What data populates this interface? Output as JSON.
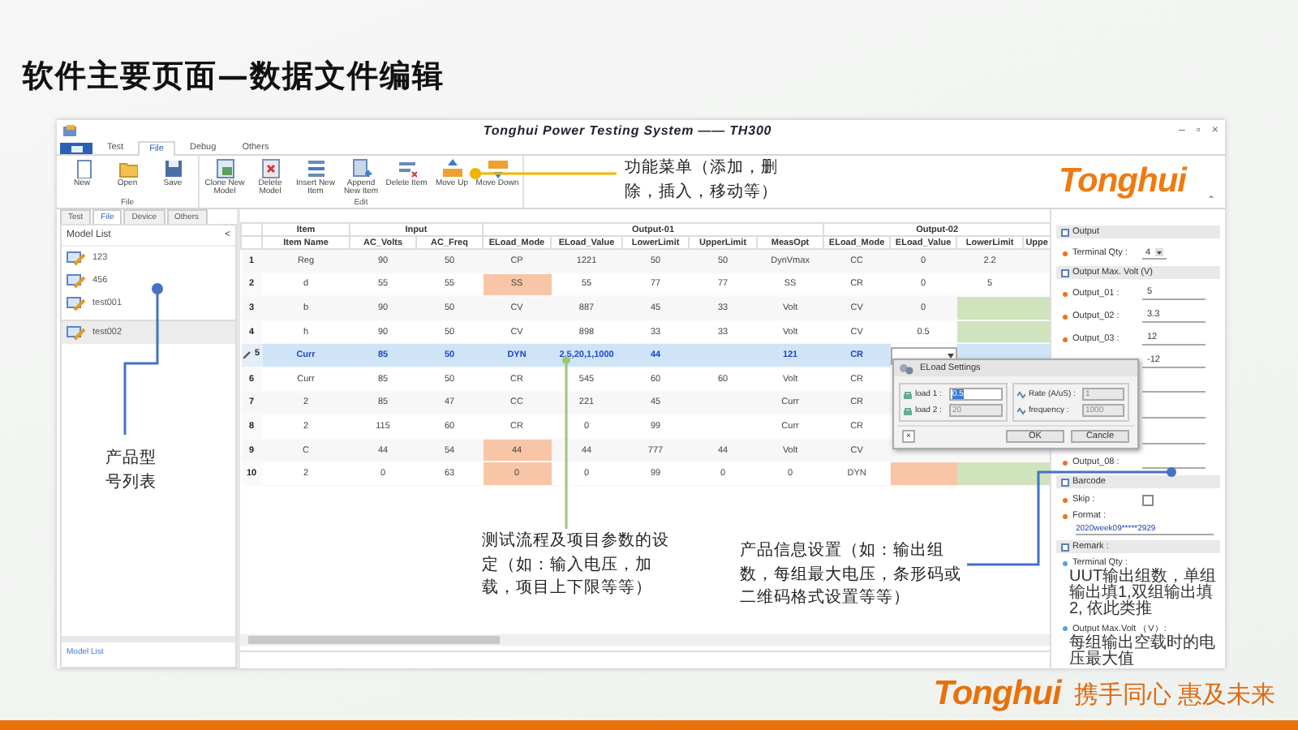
{
  "slide": {
    "title": "软件主要页面—数据文件编辑",
    "footer_logo": "Tonghui",
    "footer_slogan": "携手同心 惠及未来"
  },
  "window": {
    "title": "Tonghui Power Testing System —— TH300",
    "controls": [
      "–",
      "▫",
      "×"
    ],
    "logo": "Tonghui",
    "collapse": "⌃"
  },
  "ribbon_tabs": [
    {
      "label": "Test",
      "selected": false
    },
    {
      "label": "File",
      "selected": true
    },
    {
      "label": "Debug",
      "selected": false
    },
    {
      "label": "Others",
      "selected": false
    }
  ],
  "ribbon_groups": [
    {
      "label": "File",
      "buttons": [
        "New",
        "Open",
        "Save"
      ]
    },
    {
      "label": "Edit",
      "buttons": [
        "Clone New Model",
        "Delete Model",
        "Insert New Item",
        "Append New Item",
        "Delete Item",
        "Move Up",
        "Move Down"
      ]
    }
  ],
  "left_panel": {
    "tabs": [
      {
        "label": "Test",
        "selected": false
      },
      {
        "label": "File",
        "selected": true
      },
      {
        "label": "Device",
        "selected": false
      },
      {
        "label": "Others",
        "selected": false
      }
    ],
    "header": "Model List",
    "collapse": "<",
    "models": [
      {
        "name": "123",
        "selected": false
      },
      {
        "name": "456",
        "selected": false
      },
      {
        "name": "test001",
        "selected": false
      },
      {
        "name": "test002",
        "selected": true
      }
    ],
    "footer": "Model List"
  },
  "table": {
    "groups": [
      "Item",
      "Input",
      "Output-01",
      "Output-02"
    ],
    "columns": [
      "Item Name",
      "AC_Volts",
      "AC_Freq",
      "ELoad_Mode",
      "ELoad_Value",
      "LowerLimit",
      "UpperLimit",
      "MeasOpt",
      "ELoad_Mode",
      "ELoad_Value",
      "LowerLimit",
      "Uppe"
    ],
    "rows": [
      {
        "number": "1",
        "selected": false,
        "cells": [
          "Reg",
          "90",
          "50",
          "CP",
          "1221",
          "50",
          "50",
          "DynVmax",
          "CC",
          "0",
          "2.2"
        ]
      },
      {
        "number": "2",
        "selected": false,
        "cells": [
          "d",
          "55",
          "55",
          {
            "text": "SS",
            "color": "#f8c6a6"
          },
          "55",
          "77",
          "77",
          "SS",
          "CR",
          "0",
          "5"
        ]
      },
      {
        "number": "3",
        "selected": false,
        "cells": [
          "b",
          "90",
          "50",
          "CV",
          "887",
          "45",
          "33",
          "Volt",
          "CV",
          "0",
          {
            "color": "#cfe3bd"
          },
          {
            "color": "#cfe3bd"
          }
        ]
      },
      {
        "number": "4",
        "selected": false,
        "cells": [
          "h",
          "90",
          "50",
          "CV",
          "898",
          "33",
          "33",
          "Volt",
          "CV",
          "0.5",
          {
            "color": "#cfe3bd"
          },
          {
            "color": "#cfe3bd"
          }
        ]
      },
      {
        "number": "5",
        "selected": true,
        "cells": [
          "Curr",
          "85",
          "50",
          "DYN",
          "2.5,20,1,1000",
          "44",
          null,
          "121",
          "CR",
          {
            "kind": "dropdown"
          }
        ]
      },
      {
        "number": "6",
        "selected": false,
        "cells": [
          "Curr",
          "85",
          "50",
          "CR",
          "545",
          "60",
          "60",
          "Volt",
          "CR"
        ]
      },
      {
        "number": "7",
        "selected": false,
        "cells": [
          "2",
          "85",
          "47",
          "CC",
          "221",
          "45",
          null,
          "Curr",
          "CR"
        ]
      },
      {
        "number": "8",
        "selected": false,
        "cells": [
          "2",
          "115",
          "60",
          "CR",
          "0",
          "99",
          null,
          "Curr",
          "CR"
        ]
      },
      {
        "number": "9",
        "selected": false,
        "cells": [
          "C",
          "44",
          "54",
          {
            "text": "44",
            "color": "#f8c6a6"
          },
          "44",
          "777",
          "44",
          "Volt",
          "CV"
        ]
      },
      {
        "number": "10",
        "selected": false,
        "cells": [
          "2",
          "0",
          "63",
          {
            "text": "0",
            "color": "#f8c6a6"
          },
          "0",
          "99",
          "0",
          "0",
          "DYN",
          {
            "color": "#f8c6a6"
          },
          {
            "color": "#cfe3bd"
          },
          {
            "color": "#cfe3bd"
          }
        ]
      }
    ]
  },
  "dialog": {
    "title": "ELoad Settings",
    "fields": [
      {
        "label": "load 1 :",
        "value": "0.5",
        "disabled": false
      },
      {
        "label": "load 2 :",
        "value": "20",
        "disabled": true
      },
      {
        "label": "Rate (A/uS) :",
        "value": "1",
        "disabled": true
      },
      {
        "label": "frequency  :",
        "value": "1000",
        "disabled": true
      }
    ],
    "buttons": [
      "OK",
      "Cancle"
    ],
    "close": "×"
  },
  "properties": [
    {
      "title": "Output",
      "items": [
        {
          "kind": "dropdown",
          "label": "Terminal Qty :",
          "value": "4"
        }
      ]
    },
    {
      "title": "Output Max. Volt (V)",
      "items": [
        {
          "kind": "field",
          "label": "Output_01 :",
          "value": "5"
        },
        {
          "kind": "field",
          "label": "Output_02 :",
          "value": "3.3"
        },
        {
          "kind": "field",
          "label": "Output_03 :",
          "value": "12"
        },
        {
          "kind": "field",
          "value": "-12"
        },
        {
          "kind": "field"
        },
        {
          "kind": "field"
        },
        {
          "kind": "field"
        },
        {
          "kind": "field",
          "label": "Output_08 :"
        }
      ]
    },
    {
      "title": "Barcode",
      "items": [
        {
          "kind": "checkbox",
          "label": "Skip :",
          "checked": false
        },
        {
          "kind": "field",
          "label": "Format :",
          "value": "2020week09*****2929"
        }
      ]
    },
    {
      "title": "Remark :",
      "items": [
        {
          "kind": "note",
          "label": "Terminal Qty :",
          "text": "UUT输出组数，单组输出填1,双组输出填2, 依此类推"
        },
        {
          "kind": "note",
          "label": "Output Max.Volt （V）:",
          "text": "每组输出空载时的电压最大值"
        }
      ]
    }
  ],
  "annotations": [
    {
      "text": "功能菜单（添加，删除，插入，移动等）"
    },
    {
      "text": "产品型号列表"
    },
    {
      "text": "测试流程及项目参数的设定（如：输入电压，加载，项目上下限等等）"
    },
    {
      "text": "产品信息设置（如：输出组数，每组最大电压，条形码或二维码格式设置等等）"
    }
  ]
}
